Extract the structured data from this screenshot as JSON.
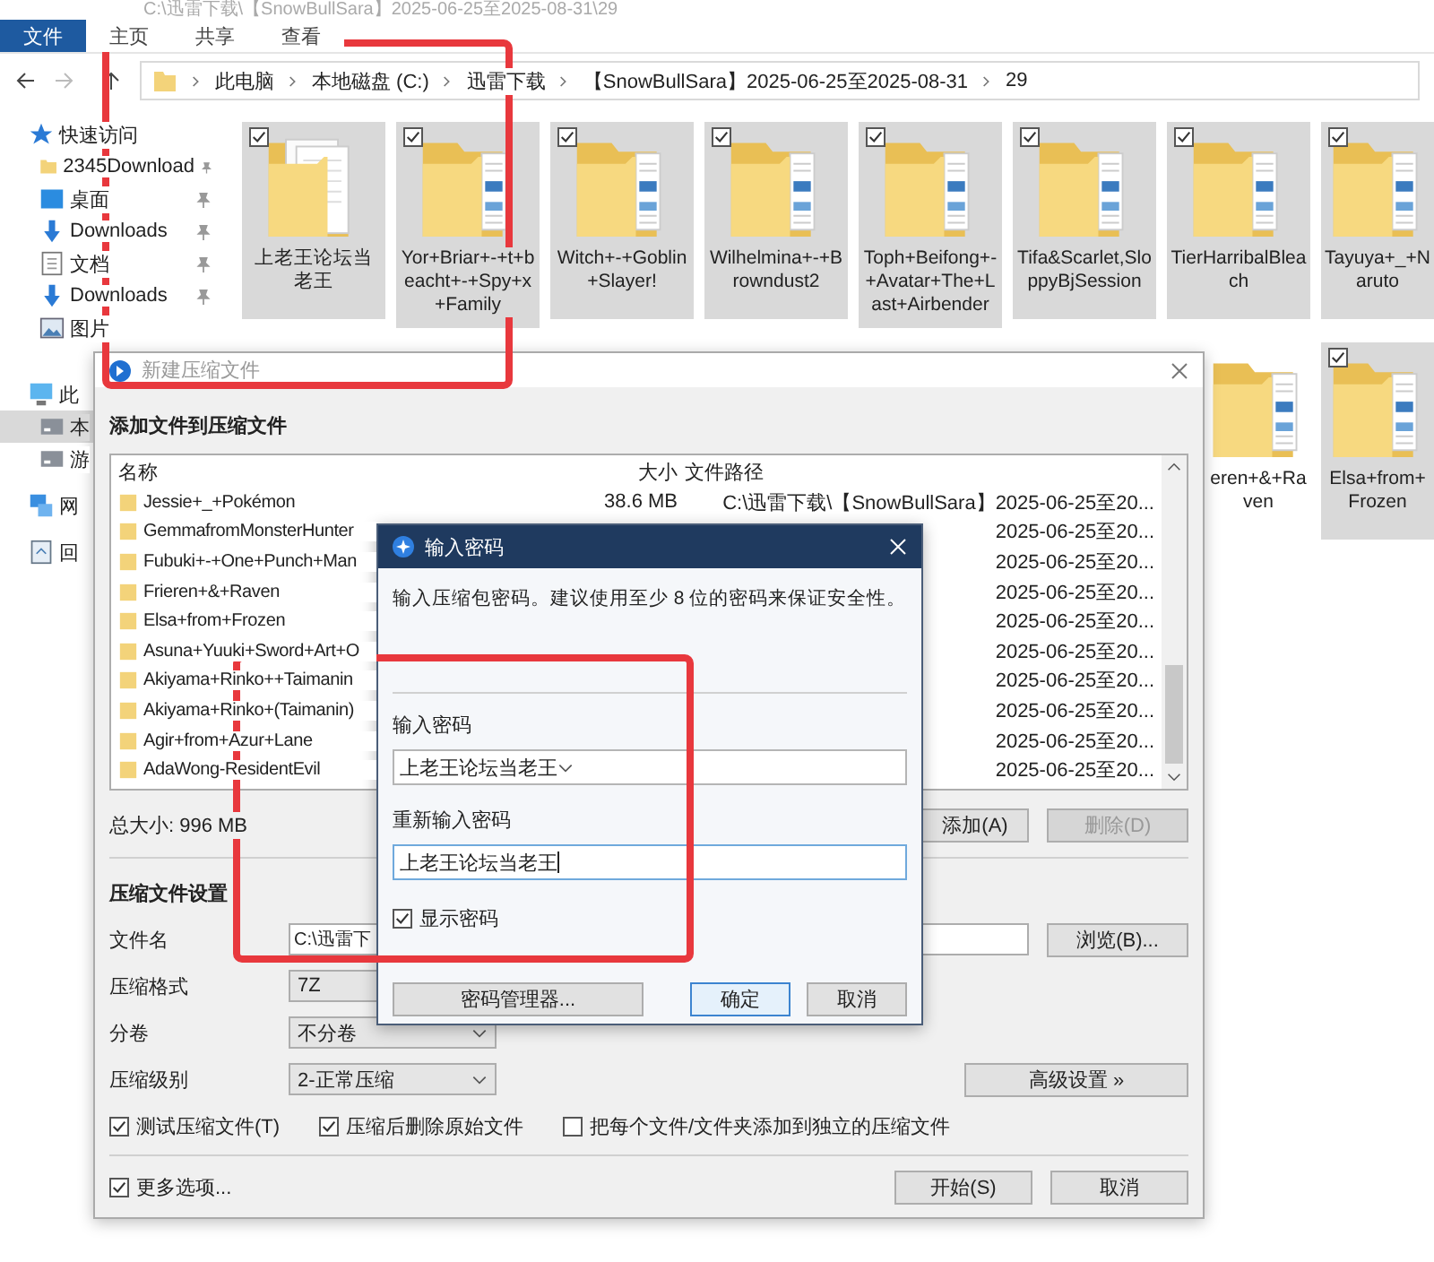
{
  "explorer": {
    "title_path": "C:\\迅雷下载\\【SnowBullSara】2025-06-25至2025-08-31\\29",
    "ribbon_tabs": [
      {
        "label": "文件",
        "selected": true
      },
      {
        "label": "主页",
        "selected": false
      },
      {
        "label": "共享",
        "selected": false
      },
      {
        "label": "查看",
        "selected": false
      }
    ],
    "breadcrumbs": [
      "此电脑",
      "本地磁盘 (C:)",
      "迅雷下载",
      "【SnowBullSara】2025-06-25至2025-08-31",
      "29"
    ],
    "sidebar": [
      {
        "label": "快速访问",
        "kind": "star",
        "selected": false,
        "children": [
          {
            "label": "2345Download",
            "kind": "folder",
            "pinned": true,
            "selected": false
          },
          {
            "label": "桌面",
            "kind": "desktop",
            "pinned": true,
            "selected": false
          },
          {
            "label": "Downloads",
            "kind": "download",
            "pinned": true,
            "selected": false
          },
          {
            "label": "文档",
            "kind": "document",
            "pinned": true,
            "selected": false
          },
          {
            "label": "Downloads",
            "kind": "download",
            "pinned": true,
            "selected": false
          },
          {
            "label": "图片",
            "kind": "picture",
            "pinned": false,
            "selected": false
          }
        ]
      },
      {
        "label": "此",
        "kind": "pc",
        "selected": false,
        "children": [
          {
            "label": "本",
            "kind": "drive",
            "pinned": false,
            "selected": true
          },
          {
            "label": "游",
            "kind": "drive",
            "pinned": false,
            "selected": false
          }
        ]
      },
      {
        "label": "网",
        "kind": "network",
        "selected": false
      },
      {
        "label": "回",
        "kind": "recycle",
        "selected": false
      }
    ],
    "folders": [
      {
        "name": "上老王论坛当老王",
        "kind": "documents",
        "checked": true
      },
      {
        "name": "Yor+Briar+-+t+beacht+-+Spy+x+Family",
        "kind": "pictures",
        "checked": true
      },
      {
        "name": "Witch+-+Goblin+Slayer!",
        "kind": "pictures",
        "checked": true
      },
      {
        "name": "Wilhelmina+-+Browndust2",
        "kind": "pictures",
        "checked": true
      },
      {
        "name": "Toph+Beifong+-+Avatar+The+Last+Airbender",
        "kind": "pictures",
        "checked": true
      },
      {
        "name": "Tifa&Scarlet,SloppyBjSession",
        "kind": "pictures",
        "checked": true
      },
      {
        "name": "TierHarribalBleach",
        "kind": "pictures",
        "checked": true
      },
      {
        "name": "Tayuya+_+Naruto",
        "kind": "pictures",
        "checked": true
      }
    ],
    "folders_lower": [
      {
        "name": "eren+&+Raven",
        "kind": "pictures"
      },
      {
        "name": "Elsa+from+Frozen",
        "kind": "pictures",
        "checked": true
      }
    ]
  },
  "archive_dialog": {
    "title": "新建压缩文件",
    "heading": "添加文件到压缩文件",
    "columns": [
      "名称",
      "大小",
      "文件路径"
    ],
    "files": [
      {
        "name": "Jessie+_+Pokémon",
        "size": "38.6 MB",
        "path": "C:\\迅雷下载\\【SnowBullSara】2025-06-25至20..."
      },
      {
        "name": "GemmafromMonsterHunter",
        "path": "2025-06-25至20..."
      },
      {
        "name": "Fubuki+-+One+Punch+Man",
        "path": "2025-06-25至20..."
      },
      {
        "name": "Frieren+&+Raven",
        "path": "2025-06-25至20..."
      },
      {
        "name": "Elsa+from+Frozen",
        "path": "2025-06-25至20..."
      },
      {
        "name": "Asuna+Yuuki+Sword+Art+O",
        "path": "2025-06-25至20..."
      },
      {
        "name": "Akiyama+Rinko++Taimanin",
        "path": "2025-06-25至20..."
      },
      {
        "name": "Akiyama+Rinko+(Taimanin)",
        "path": "2025-06-25至20..."
      },
      {
        "name": "Agir+from+Azur+Lane",
        "path": "2025-06-25至20..."
      },
      {
        "name": "AdaWong-ResidentEvil",
        "path": "2025-06-25至20..."
      }
    ],
    "total": "总大小: 996 MB",
    "add_button": {
      "label": "添加(A)",
      "disabled": false
    },
    "remove_button": {
      "label": "删除(D)",
      "disabled": true
    },
    "settings_heading": "压缩文件设置",
    "fields": [
      {
        "label": "文件名",
        "kind": "text",
        "value": "C:\\迅雷下"
      },
      {
        "label": "压缩格式",
        "kind": "select",
        "value": "7Z"
      },
      {
        "label": "分卷",
        "kind": "select",
        "value": "不分卷"
      },
      {
        "label": "压缩级别",
        "kind": "select",
        "value": "2-正常压缩"
      }
    ],
    "browse_button": "浏览(B)...",
    "advanced_button": "高级设置 »",
    "options": [
      {
        "label": "测试压缩文件(T)",
        "checked": true
      },
      {
        "label": "压缩后删除原始文件",
        "checked": true
      },
      {
        "label": "把每个文件/文件夹添加到独立的压缩文件",
        "checked": false
      }
    ],
    "more_options": {
      "label": "更多选项...",
      "checked": true
    },
    "start_button": "开始(S)",
    "cancel_button": "取消"
  },
  "password_dialog": {
    "title": "输入密码",
    "hint": "输入压缩包密码。建议使用至少 8 位的密码来保证安全性。",
    "password_label": "输入密码",
    "password": "上老王论坛当老王",
    "confirm_label": "重新输入密码",
    "confirm": "上老王论坛当老王",
    "show_password": {
      "label": "显示密码",
      "checked": true
    },
    "manager_button": "密码管理器...",
    "ok_button": "确定",
    "cancel_button": "取消"
  }
}
